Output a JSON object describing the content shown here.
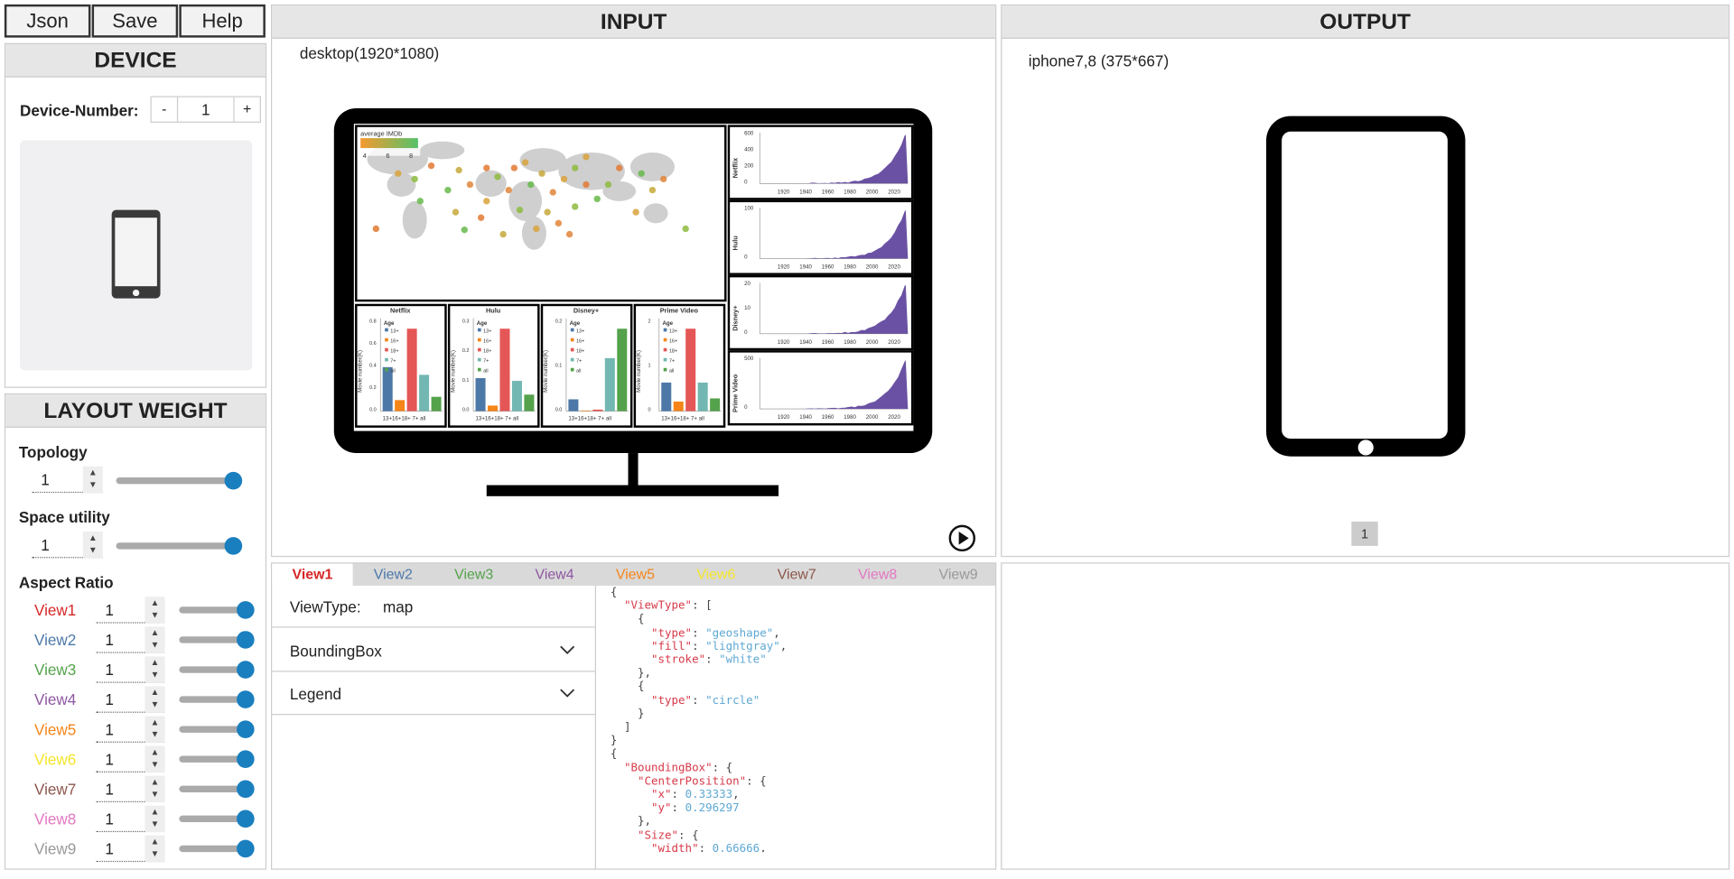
{
  "toolbar": {
    "json_label": "Json",
    "save_label": "Save",
    "help_label": "Help"
  },
  "device": {
    "title": "DEVICE",
    "number_label": "Device-Number:",
    "minus": "-",
    "plus": "+",
    "number_value": "1"
  },
  "layout_weight": {
    "title": "LAYOUT WEIGHT",
    "topology": {
      "label": "Topology",
      "value": "1",
      "slider": 1.0
    },
    "space_utility": {
      "label": "Space utility",
      "value": "1",
      "slider": 1.0
    },
    "aspect_ratio": {
      "label": "Aspect Ratio",
      "views": [
        {
          "name": "View1",
          "value": "1",
          "color": "#d62728"
        },
        {
          "name": "View2",
          "value": "1",
          "color": "#4c78a8"
        },
        {
          "name": "View3",
          "value": "1",
          "color": "#54a24b"
        },
        {
          "name": "View4",
          "value": "1",
          "color": "#8e57a2"
        },
        {
          "name": "View5",
          "value": "1",
          "color": "#f58518"
        },
        {
          "name": "View6",
          "value": "1",
          "color": "#f5e52a"
        },
        {
          "name": "View7",
          "value": "1",
          "color": "#8c564b"
        },
        {
          "name": "View8",
          "value": "1",
          "color": "#e377c2"
        },
        {
          "name": "View9",
          "value": "1",
          "color": "#999999"
        }
      ]
    }
  },
  "input": {
    "title": "INPUT",
    "device_label": "desktop(1920*1080)"
  },
  "output": {
    "title": "OUTPUT",
    "device_label": "iphone7,8 (375*667)",
    "page": "1"
  },
  "views_panel": {
    "tabs": [
      {
        "label": "View1",
        "color": "#d62728"
      },
      {
        "label": "View2",
        "color": "#4c78a8"
      },
      {
        "label": "View3",
        "color": "#54a24b"
      },
      {
        "label": "View4",
        "color": "#8e57a2"
      },
      {
        "label": "View5",
        "color": "#f58518"
      },
      {
        "label": "View6",
        "color": "#f5e52a"
      },
      {
        "label": "View7",
        "color": "#8c564b"
      },
      {
        "label": "View8",
        "color": "#e377c2"
      },
      {
        "label": "View9",
        "color": "#999999"
      }
    ],
    "viewtype_label": "ViewType:",
    "viewtype_value": "map",
    "bounding_box_label": "BoundingBox",
    "legend_label": "Legend"
  },
  "dashboard": {
    "map_legend_title": "average IMDb",
    "map_legend_ticks": [
      "4",
      "6",
      "8"
    ],
    "area_charts": [
      {
        "name": "Netflix",
        "yticks": [
          "600",
          "400",
          "200",
          "0"
        ]
      },
      {
        "name": "Hulu",
        "yticks": [
          "100",
          "0"
        ]
      },
      {
        "name": "Disney+",
        "yticks": [
          "20",
          "10",
          "0"
        ]
      },
      {
        "name": "Prime Video",
        "yticks": [
          "500",
          "0"
        ]
      }
    ],
    "area_xticks": [
      "1920",
      "1940",
      "1960",
      "1980",
      "2000",
      "2020"
    ],
    "bar_charts": [
      {
        "name": "Netflix",
        "values": [
          0.4,
          0.1,
          0.75,
          0.33,
          0.13
        ],
        "yticks": [
          "0.8",
          "0.6",
          "0.4",
          "0.2",
          "0.0"
        ]
      },
      {
        "name": "Hulu",
        "values": [
          0.12,
          0.02,
          0.3,
          0.11,
          0.06
        ],
        "yticks": [
          "0.3",
          "0.2",
          "0.1",
          "0.0"
        ]
      },
      {
        "name": "Disney+",
        "values": [
          0.04,
          0.002,
          0.005,
          0.18,
          0.28
        ],
        "yticks": [
          "0.2",
          "0.1",
          "0.0"
        ]
      },
      {
        "name": "Prime Video",
        "values": [
          0.9,
          0.3,
          2.6,
          0.9,
          0.4
        ],
        "yticks": [
          "2",
          "1",
          "0"
        ]
      }
    ],
    "bar_legend_title": "Age",
    "bar_legend": [
      "13+",
      "16+",
      "18+",
      "7+",
      "all"
    ],
    "bar_colors": [
      "#4c78a8",
      "#f58518",
      "#e45756",
      "#72b7b2",
      "#54a24b"
    ],
    "bar_ylabel": "Movie number(K)",
    "bar_xticks": "13+16+18+ 7+ all"
  },
  "json_panel": {
    "lines": [
      "{",
      "  \"ViewType\": [",
      "    {",
      "      \"type\": \"geoshape\",",
      "      \"fill\": \"lightgray\",",
      "      \"stroke\": \"white\"",
      "    },",
      "    {",
      "      \"type\": \"circle\"",
      "    }",
      "  ]",
      "}",
      "{",
      "  \"BoundingBox\": {",
      "    \"CenterPosition\": {",
      "      \"x\": 0.33333,",
      "      \"y\": 0.296297",
      "    },",
      "    \"Size\": {",
      "      \"width\": 0.66666,"
    ]
  }
}
